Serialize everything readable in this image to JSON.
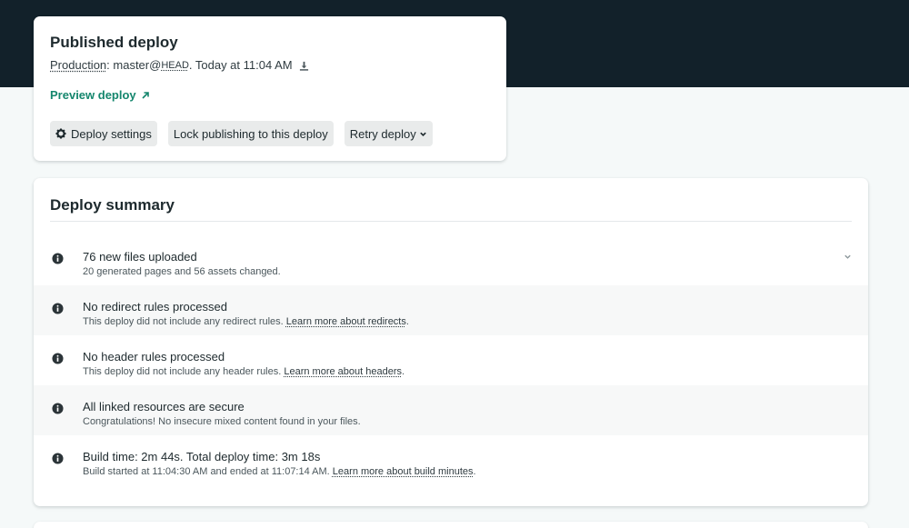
{
  "deploy": {
    "title": "Published deploy",
    "context_label": "Production",
    "branch": "master@",
    "ref": "HEAD",
    "time_text": ". Today at 11:04 AM",
    "preview_label": "Preview deploy",
    "buttons": {
      "settings": "Deploy settings",
      "lock": "Lock publishing to this deploy",
      "retry": "Retry deploy"
    }
  },
  "summary": {
    "title": "Deploy summary",
    "items": [
      {
        "title": "76 new files uploaded",
        "desc": "20 generated pages and 56 assets changed.",
        "link": "",
        "expandable": true
      },
      {
        "title": "No redirect rules processed",
        "desc": "This deploy did not include any redirect rules. ",
        "link": "Learn more about redirects",
        "after": "."
      },
      {
        "title": "No header rules processed",
        "desc": "This deploy did not include any header rules. ",
        "link": "Learn more about headers",
        "after": "."
      },
      {
        "title": "All linked resources are secure",
        "desc": "Congratulations! No insecure mixed content found in your files.",
        "link": ""
      },
      {
        "title": "Build time: 2m 44s. Total deploy time: 3m 18s",
        "desc": "Build started at 11:04:30 AM and ended at 11:07:14 AM. ",
        "link": "Learn more about build minutes",
        "after": "."
      }
    ]
  },
  "colors": {
    "topbar": "#12212a",
    "link_accent": "#14866d",
    "page_bg": "#f5f9f9"
  },
  "icons": {
    "download": "download-icon",
    "external": "external-link-icon",
    "gear": "gear-icon",
    "chevron": "chevron-down-icon",
    "info": "info-icon"
  }
}
